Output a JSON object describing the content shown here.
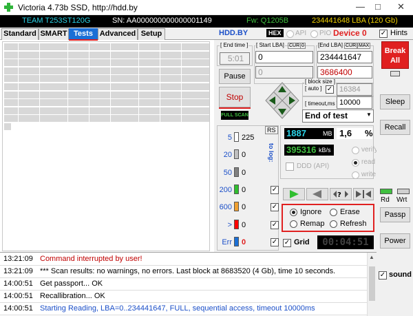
{
  "window": {
    "title": "Victoria 4.73b SSD, http://hdd.by",
    "minimize": "—",
    "maximize": "□",
    "close": "✕"
  },
  "infobar": {
    "model": "TEAM T253ST120G",
    "serial": "SN: AA000000000000001149",
    "firmware": "Fw: Q1205B",
    "capacity": "234441648 LBA (120 Gb)"
  },
  "tabs": [
    {
      "label": "Standard"
    },
    {
      "label": "SMART"
    },
    {
      "label": "Tests"
    },
    {
      "label": "Advanced"
    },
    {
      "label": "Setup"
    }
  ],
  "tabbar": {
    "site": "HDD.BY",
    "hex": "HEX",
    "api": "API",
    "pio": "PIO",
    "device": "Device 0",
    "hints": "Hints",
    "hints_checked": true
  },
  "controls": {
    "end_time_label": "[ End time ]",
    "end_time_value": "5:01",
    "start_lba_label": "[ Start LBA]",
    "start_lba_value": "0",
    "start_lba_cur_value": "0",
    "cur_label": "CUR",
    "cur_value": "0",
    "cur2_label": "CUR",
    "max_label": "MAX",
    "end_lba_label": "[End LBA]",
    "end_lba_value": "234441647",
    "end_lba_cur_value": "3686400",
    "pause": "Pause",
    "stop": "Stop",
    "full_scan": "FULL SCAN",
    "block_size_label": "[ block size ]",
    "block_size_sub": "[ auto ]",
    "block_size_value": "16384",
    "timeout_label": "[ timeout,ms ]",
    "timeout_value": "10000",
    "end_action": "End of test"
  },
  "counters": {
    "rs": "RS",
    "to_log": "to log:",
    "rows": [
      {
        "label": "5",
        "value": "225",
        "color": "#ffffff",
        "level": 0.9
      },
      {
        "label": "20",
        "value": "0",
        "color": "#c0c0c0",
        "level": 0.9
      },
      {
        "label": "50",
        "value": "0",
        "color": "#808080",
        "level": 0.9
      },
      {
        "label": "200",
        "value": "0",
        "color": "#2fbe2f",
        "level": 0.9
      },
      {
        "label": "600",
        "value": "0",
        "color": "#f0a030",
        "level": 0.9
      },
      {
        "label": ">",
        "value": "0",
        "color": "#ff0000",
        "level": 0.9
      },
      {
        "label": "Err",
        "value": "0",
        "color": "#1b6fd6",
        "level": 0.9
      }
    ]
  },
  "stats": {
    "mb_value": "1887",
    "mb_unit": "MB",
    "pct_value": "1,6",
    "pct_unit": "%",
    "speed_value": "395316",
    "speed_unit": "kB/s",
    "verify": "verify",
    "read": "read",
    "write": "write",
    "ddd_api": "DDD (API)"
  },
  "modes": {
    "ignore": "Ignore",
    "erase": "Erase",
    "remap": "Remap",
    "refresh": "Refresh",
    "grid": "Grid",
    "timer": "00:04:51"
  },
  "right_panel": {
    "break_all": "Break All",
    "sleep": "Sleep",
    "recall": "Recall",
    "rd": "Rd",
    "wrt": "Wrt",
    "passp": "Passp",
    "power": "Power",
    "sound": "sound"
  },
  "log": [
    {
      "time": "13:21:09",
      "msg": "Command interrupted by user!",
      "color": "#c00000"
    },
    {
      "time": "13:21:09",
      "msg": "*** Scan results: no warnings, no errors. Last block at 8683520 (4 Gb), time 10 seconds.",
      "color": "#000000"
    },
    {
      "time": "14:00:51",
      "msg": "Get passport... OK",
      "color": "#000000"
    },
    {
      "time": "14:00:51",
      "msg": "Recallibration... OK",
      "color": "#000000"
    },
    {
      "time": "14:00:51",
      "msg": "Starting Reading, LBA=0..234441647, FULL, sequential access, timeout 10000ms",
      "color": "#1b4fc8"
    }
  ],
  "colors": {
    "accent": "#1b6fd6",
    "break_bg": "#e02020",
    "cyan": "#2ad4e8",
    "yellow": "#f0d000",
    "green": "#40c040"
  }
}
